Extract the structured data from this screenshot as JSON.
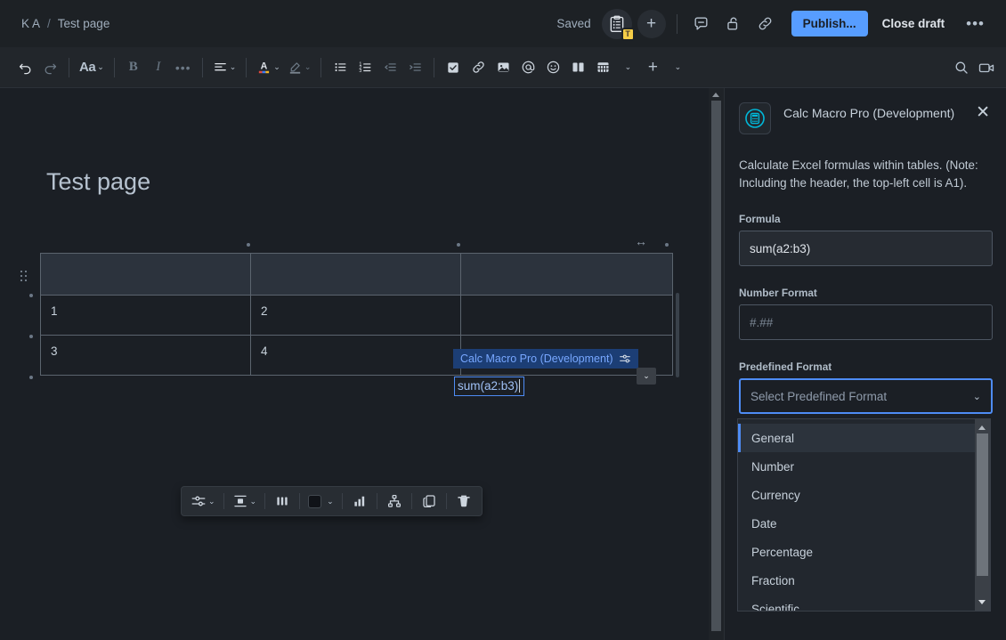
{
  "breadcrumb": {
    "space": "K A",
    "separator": "/",
    "page": "Test page"
  },
  "topbar": {
    "saved_label": "Saved",
    "avatar_badge": "T",
    "add_label": "+",
    "comment_icon": "comment-icon",
    "restrictions_icon": "unlock-icon",
    "copy_link_icon": "link-icon",
    "publish_label": "Publish...",
    "close_draft_label": "Close draft",
    "more_label": "•••"
  },
  "toolbar": {
    "undo": "undo-icon",
    "redo": "redo-icon",
    "text_style": "Aa",
    "bold": "B",
    "italic": "I",
    "more_formatting": "•••",
    "alignment": "align-icon",
    "text_color": "A",
    "highlight": "highlight-icon",
    "bullet_list": "bullet-list-icon",
    "numbered_list": "numbered-list-icon",
    "outdent": "outdent-icon",
    "indent": "indent-icon",
    "task_list": "task-checkbox-icon",
    "link": "link-icon",
    "image": "image-icon",
    "mention": "@",
    "emoji": "emoji-icon",
    "layout": "layout-columns-icon",
    "table": "table-icon",
    "table_chevron": "chevron-down-icon",
    "insert": "+",
    "insert_chevron": "chevron-down-icon",
    "find": "search-icon",
    "loom": "video-camera-icon"
  },
  "document": {
    "title": "Test page",
    "resize_handle": "↔",
    "table": {
      "headers": [
        "",
        "",
        ""
      ],
      "rows": [
        [
          "1",
          "2",
          ""
        ],
        [
          "3",
          "4",
          "macro"
        ]
      ]
    },
    "macro_chip": {
      "label": "Calc Macro Pro (Development)",
      "config_icon": "macro-settings-icon",
      "caret": "⌄",
      "value": "sum(a2:b3)"
    }
  },
  "table_toolbar": {
    "options": "table-options-icon",
    "options_chevron": "⌄",
    "cell_align": "cell-align-icon",
    "cell_align_chevron": "⌄",
    "distribute_columns": "distribute-columns-icon",
    "cell_background": "color-swatch",
    "cell_background_chevron": "⌄",
    "chart": "chart-icon",
    "hierarchy": "hierarchy-icon",
    "copy": "copy-icon",
    "delete": "trash-icon"
  },
  "panel": {
    "app_icon": "calculator-icon",
    "title": "Calc Macro Pro (Development)",
    "close": "✕",
    "description": "Calculate Excel formulas within tables. (Note: Including the header, the top-left cell is A1).",
    "fields": {
      "formula": {
        "label": "Formula",
        "value": "sum(a2:b3)"
      },
      "number_format": {
        "label": "Number Format",
        "value": "#.##"
      },
      "predefined_format": {
        "label": "Predefined Format",
        "value": "Select Predefined Format",
        "chevron": "⌄"
      }
    },
    "dropdown": {
      "options": [
        "General",
        "Number",
        "Currency",
        "Date",
        "Percentage",
        "Fraction",
        "Scientific"
      ],
      "selected": "General"
    }
  },
  "colors": {
    "accent": "#579dff",
    "focus": "#4e8cf5",
    "badge": "#f5cd47",
    "app_icon": "#00b8d9",
    "chip_bg": "#1c3e75"
  }
}
